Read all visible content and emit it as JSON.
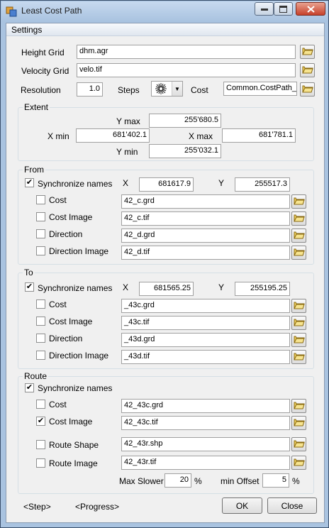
{
  "window": {
    "title": "Least Cost Path"
  },
  "menu": {
    "settings": "Settings"
  },
  "top": {
    "height_grid_label": "Height Grid",
    "height_grid_value": "dhm.agr",
    "velocity_grid_label": "Velocity Grid",
    "velocity_grid_value": "velo.tif",
    "resolution_label": "Resolution",
    "resolution_value": "1.0",
    "steps_label": "Steps",
    "cost_label": "Cost",
    "cost_value": "Common.CostPath_S"
  },
  "extent": {
    "title": "Extent",
    "ymax_label": "Y max",
    "ymax_value": "255'680.5",
    "xmin_label": "X min",
    "xmin_value": "681'402.1",
    "xmax_label": "X max",
    "xmax_value": "681'781.1",
    "ymin_label": "Y min",
    "ymin_value": "255'032.1"
  },
  "from": {
    "title": "From",
    "sync_label": "Synchronize names",
    "sync_checked": true,
    "x_label": "X",
    "x_value": "681617.9",
    "y_label": "Y",
    "y_value": "255517.3",
    "rows": [
      {
        "label": "Cost",
        "value": "42_c.grd"
      },
      {
        "label": "Cost Image",
        "value": "42_c.tif"
      },
      {
        "label": "Direction",
        "value": "42_d.grd"
      },
      {
        "label": "Direction Image",
        "value": "42_d.tif"
      }
    ]
  },
  "to": {
    "title": "To",
    "sync_label": "Synchronize names",
    "sync_checked": true,
    "x_label": "X",
    "x_value": "681565.25",
    "y_label": "Y",
    "y_value": "255195.25",
    "rows": [
      {
        "label": "Cost",
        "value": "_43c.grd"
      },
      {
        "label": "Cost Image",
        "value": "_43c.tif"
      },
      {
        "label": "Direction",
        "value": "_43d.grd"
      },
      {
        "label": "Direction Image",
        "value": "_43d.tif"
      }
    ]
  },
  "route": {
    "title": "Route",
    "sync_label": "Synchronize names",
    "sync_checked": true,
    "rows": [
      {
        "label": "Cost",
        "value": "42_43c.grd",
        "checked": false
      },
      {
        "label": "Cost Image",
        "value": "42_43c.tif",
        "checked": true
      },
      {
        "label": "Route Shape",
        "value": "42_43r.shp",
        "checked": false
      },
      {
        "label": "Route Image",
        "value": "42_43r.tif",
        "checked": false
      }
    ],
    "max_slower_label": "Max Slower",
    "max_slower_value": "20",
    "max_slower_unit": "%",
    "min_offset_label": "min Offset",
    "min_offset_value": "5",
    "min_offset_unit": "%"
  },
  "footer": {
    "step": "<Step>",
    "progress": "<Progress>",
    "ok": "OK",
    "close": "Close"
  },
  "icons": {
    "browse": "folder-open-icon",
    "steps": "compass-star-icon"
  },
  "colors": {
    "chrome": "#a9c3e0",
    "dialog_bg": "#f0f0f0",
    "close_button": "#c7412a"
  }
}
